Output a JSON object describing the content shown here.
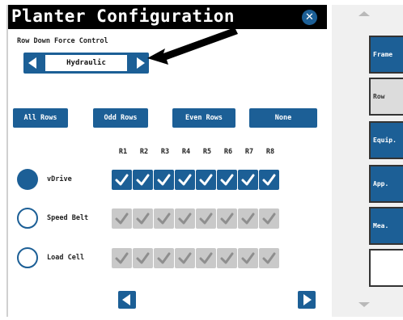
{
  "dialog": {
    "title": "Planter Configuration",
    "close_icon": "close-icon"
  },
  "row_down_force": {
    "label": "Row Down Force Control",
    "value": "Hydraulic"
  },
  "select_buttons": [
    "All Rows",
    "Odd Rows",
    "Even Rows",
    "None"
  ],
  "columns": [
    "R1",
    "R2",
    "R3",
    "R4",
    "R5",
    "R6",
    "R7",
    "R8"
  ],
  "rows": [
    {
      "label": "vDrive",
      "selected": true,
      "checks": [
        true,
        true,
        true,
        true,
        true,
        true,
        true,
        true
      ]
    },
    {
      "label": "Speed Belt",
      "selected": false,
      "checks": [
        false,
        false,
        false,
        false,
        false,
        false,
        false,
        false
      ]
    },
    {
      "label": "Load Cell",
      "selected": false,
      "checks": [
        false,
        false,
        false,
        false,
        false,
        false,
        false,
        false
      ]
    }
  ],
  "side_tabs": [
    "Frame",
    "Row",
    "Equip.",
    "App.",
    "Mea.",
    ""
  ],
  "colors": {
    "accent": "#1c5f96",
    "title_bar": "#000000",
    "check_off": "#c9c9c9",
    "side_panel": "#f0f0f0"
  }
}
